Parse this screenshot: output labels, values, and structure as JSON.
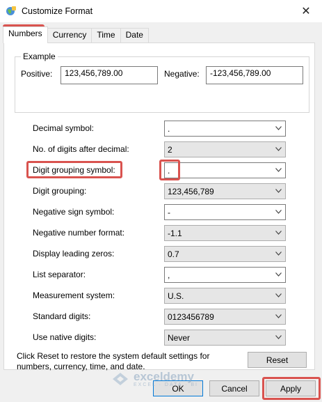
{
  "window": {
    "title": "Customize Format",
    "close_glyph": "✕"
  },
  "tabs": [
    {
      "label": "Numbers",
      "active": true
    },
    {
      "label": "Currency",
      "active": false
    },
    {
      "label": "Time",
      "active": false
    },
    {
      "label": "Date",
      "active": false
    }
  ],
  "example": {
    "legend": "Example",
    "positive_label": "Positive:",
    "positive_value": "123,456,789.00",
    "negative_label": "Negative:",
    "negative_value": "-123,456,789.00"
  },
  "settings": [
    {
      "label": "Decimal symbol:",
      "value": ".",
      "readonly": false
    },
    {
      "label": "No. of digits after decimal:",
      "value": "2",
      "readonly": true
    },
    {
      "label": "Digit grouping symbol:",
      "value": ".",
      "readonly": false
    },
    {
      "label": "Digit grouping:",
      "value": "123,456,789",
      "readonly": true
    },
    {
      "label": "Negative sign symbol:",
      "value": "-",
      "readonly": false
    },
    {
      "label": "Negative number format:",
      "value": "-1.1",
      "readonly": true
    },
    {
      "label": "Display leading zeros:",
      "value": "0.7",
      "readonly": true
    },
    {
      "label": "List separator:",
      "value": ",",
      "readonly": false
    },
    {
      "label": "Measurement system:",
      "value": "U.S.",
      "readonly": true
    },
    {
      "label": "Standard digits:",
      "value": "0123456789",
      "readonly": true
    },
    {
      "label": "Use native digits:",
      "value": "Never",
      "readonly": true
    }
  ],
  "reset_note": "Click Reset to restore the system default settings for numbers, currency, time, and date.",
  "buttons": {
    "reset": "Reset",
    "ok": "OK",
    "cancel": "Cancel",
    "apply": "Apply"
  },
  "watermark": {
    "name": "exceldemy",
    "tagline": "EXCEL · DATA · BI"
  },
  "colors": {
    "highlight": "#d9534f",
    "accent": "#0078d7"
  }
}
